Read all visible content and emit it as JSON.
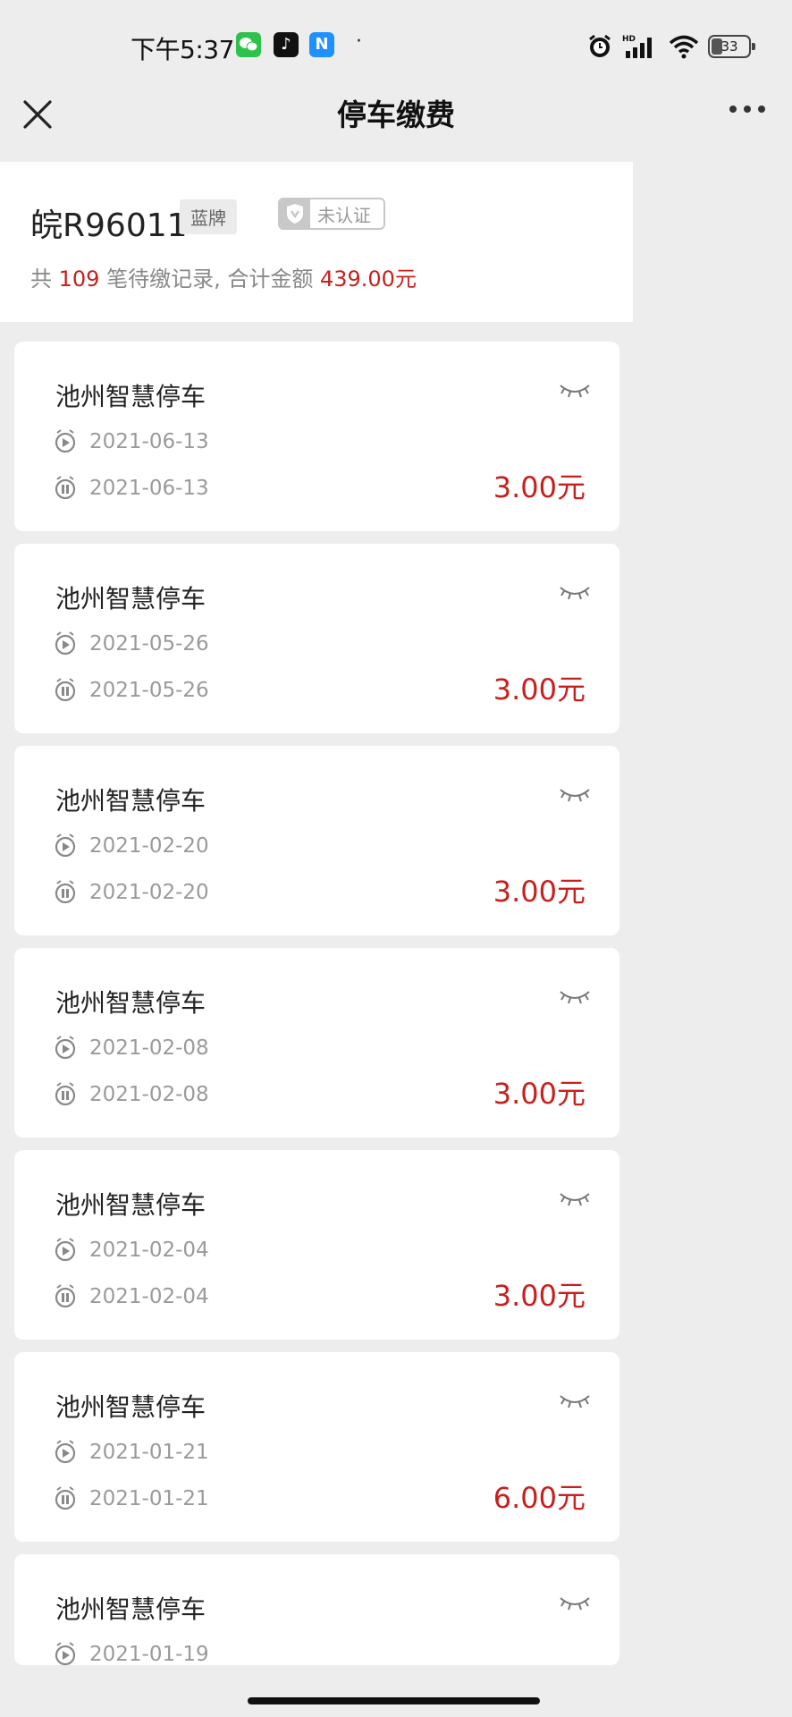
{
  "status_bar": {
    "time": "下午5:37",
    "battery": "33",
    "dot": "·",
    "icons": [
      "wechat-icon",
      "tiktok-icon",
      "n-app-icon",
      "alarm-icon",
      "signal-hd-icon",
      "wifi-icon",
      "battery-icon"
    ]
  },
  "nav": {
    "title": "停车缴费"
  },
  "vehicle": {
    "plate": "皖R96011",
    "plate_type": "蓝牌",
    "verify_status": "未认证"
  },
  "summary": {
    "prefix": "共 ",
    "count": "109",
    "middle": " 笔待缴记录, 合计金额 ",
    "total": "439.00元"
  },
  "records": [
    {
      "name": "池州智慧停车",
      "start": "2021-06-13",
      "end": "2021-06-13",
      "amount": "3.00元"
    },
    {
      "name": "池州智慧停车",
      "start": "2021-05-26",
      "end": "2021-05-26",
      "amount": "3.00元"
    },
    {
      "name": "池州智慧停车",
      "start": "2021-02-20",
      "end": "2021-02-20",
      "amount": "3.00元"
    },
    {
      "name": "池州智慧停车",
      "start": "2021-02-08",
      "end": "2021-02-08",
      "amount": "3.00元"
    },
    {
      "name": "池州智慧停车",
      "start": "2021-02-04",
      "end": "2021-02-04",
      "amount": "3.00元"
    },
    {
      "name": "池州智慧停车",
      "start": "2021-01-21",
      "end": "2021-01-21",
      "amount": "6.00元"
    },
    {
      "name": "池州智慧停车",
      "start": "2021-01-19",
      "end": "",
      "amount": ""
    }
  ],
  "colors": {
    "accent_red": "#c8201d",
    "background": "#ededed",
    "card": "#ffffff"
  }
}
